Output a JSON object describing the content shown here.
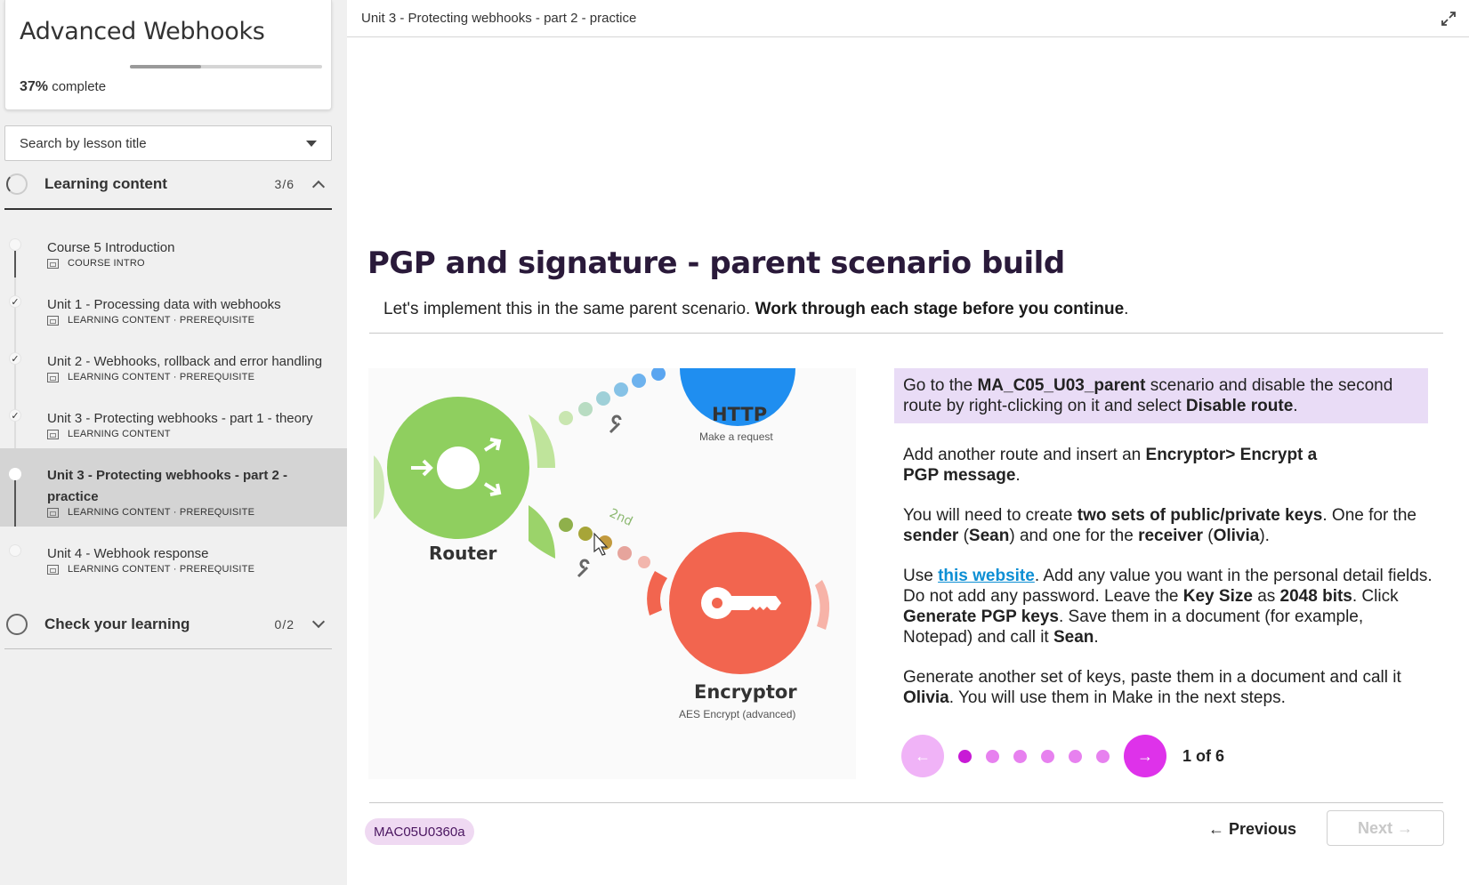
{
  "sidebar": {
    "course_title": "Advanced Webhooks",
    "progress_percent": "37%",
    "progress_suffix": "complete",
    "progress_fraction": 0.37,
    "search_placeholder": "Search by lesson title",
    "sections": [
      {
        "title": "Learning content",
        "count": "3/6",
        "expanded": true
      },
      {
        "title": "Check your learning",
        "count": "0/2",
        "expanded": false
      }
    ],
    "lessons": [
      {
        "title": "Course 5 Introduction",
        "meta": "COURSE INTRO",
        "done": false,
        "icon": "document-icon"
      },
      {
        "title": "Unit 1 - Processing data with webhooks",
        "meta": "LEARNING CONTENT · PREREQUISITE",
        "done": true,
        "icon": "slides-icon"
      },
      {
        "title": "Unit 2 - Webhooks, rollback and error handling",
        "meta": "LEARNING CONTENT · PREREQUISITE",
        "done": true,
        "icon": "slides-icon"
      },
      {
        "title": "Unit 3 - Protecting webhooks - part 1 - theory",
        "meta": "LEARNING CONTENT",
        "done": true,
        "icon": "slides-icon"
      },
      {
        "title": "Unit 3 - Protecting webhooks - part 2 - practice",
        "meta": "LEARNING CONTENT · PREREQUISITE",
        "done": false,
        "active": true,
        "icon": "slides-icon"
      },
      {
        "title": "Unit 4 - Webhook response",
        "meta": "LEARNING CONTENT · PREREQUISITE",
        "done": false,
        "icon": "slides-icon"
      }
    ],
    "check_mark": "✓"
  },
  "main": {
    "topbar_title": "Unit 3 - Protecting webhooks - part 2 - practice",
    "heading": "PGP and signature - parent scenario build",
    "intro_plain": "Let's implement this in the same parent scenario. ",
    "intro_bold": "Work through each stage before you continue",
    "intro_end": ".",
    "diagram": {
      "router_label": "Router",
      "http_label": "HTTP",
      "http_sub": "Make a request",
      "encryptor_label": "Encryptor",
      "encryptor_sub": "AES Encrypt (advanced)",
      "route_tag": "2nd",
      "colors": {
        "router": "#8fcf5f",
        "http": "#1f8ef0",
        "encryptor": "#f2654f"
      }
    },
    "steps": {
      "s1": [
        "Go to the ",
        "MA_C05_U03_parent",
        " scenario and disable the second route by right-clicking on it and select ",
        "Disable route",
        "."
      ],
      "s2": [
        "Add another route and insert an ",
        "Encryptor> Encrypt a PGP message",
        "."
      ],
      "s3": [
        "You will need to create ",
        "two sets of public/private keys",
        ". One for the ",
        "sender",
        " (",
        "Sean",
        ") and one for the ",
        "receiver",
        " (",
        "Olivia",
        ")."
      ],
      "s4": [
        "Use ",
        "this website",
        ". Add any value you want in the personal detail fields. Do not add any password. Leave the ",
        "Key Size",
        " as ",
        "2048 bits",
        ". Click ",
        "Generate PGP keys",
        ". Save them in a document (for example, Notepad) and call it ",
        "Sean",
        "."
      ],
      "s5": [
        "Generate another set of keys, paste them in a document and call it ",
        "Olivia",
        ". You will use them in Make in the next steps."
      ]
    },
    "carousel": {
      "counter": "1 of 6",
      "total": 6,
      "current": 1,
      "prev_icon": "←",
      "next_icon": "→"
    },
    "code": "MAC05U0360a",
    "previous_label": "← Previous",
    "next_label": "Next →",
    "accent": "#de32ea",
    "highlight": "#e9dcf6"
  }
}
